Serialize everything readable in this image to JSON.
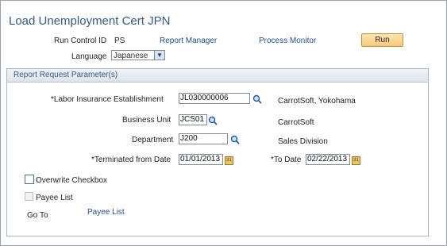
{
  "page": {
    "title": "Load Unemployment Cert JPN"
  },
  "run_control": {
    "label": "Run Control ID",
    "value": "PS",
    "report_manager": "Report Manager",
    "process_monitor": "Process Monitor",
    "run_button": "Run"
  },
  "language": {
    "label": "Language",
    "selected": "Japanese"
  },
  "group": {
    "title": "Report Request Parameter(s)"
  },
  "fields": {
    "labor_label": "*Labor Insurance Establishment",
    "labor_value": "JL030000006",
    "labor_desc": "CarrotSoft, Yokohama",
    "bu_label": "Business Unit",
    "bu_value": "JCS01",
    "bu_desc": "CarrotSoft",
    "dept_label": "Department",
    "dept_value": "J200",
    "dept_desc": "Sales Division",
    "term_from_label": "*Terminated from Date",
    "term_from_value": "01/01/2013",
    "to_date_label": "*To Date",
    "to_date_value": "02/22/2013"
  },
  "options": {
    "overwrite_label": "Overwrite Checkbox",
    "payee_list_label": "Payee List",
    "goto_label": "Go To",
    "payee_list_link": "Payee List"
  },
  "colors": {
    "title": "#345a84",
    "link": "#1d4f8a",
    "run_button": "#f7c97a"
  }
}
